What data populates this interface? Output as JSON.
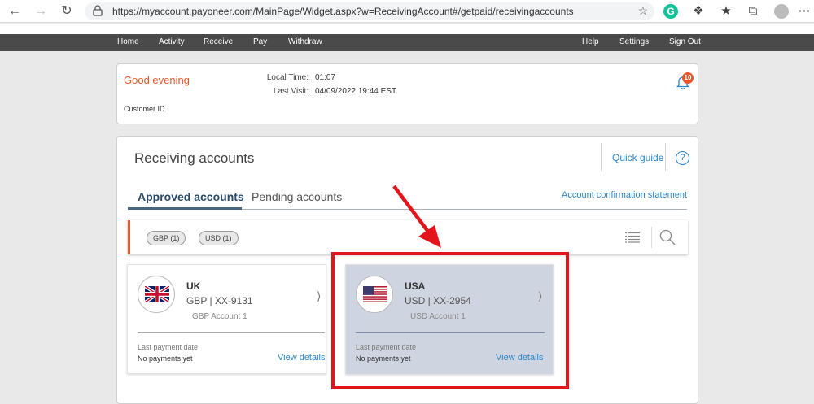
{
  "browser": {
    "url": "https://myaccount.payoneer.com/MainPage/Widget.aspx?w=ReceivingAccount#/getpaid/receivingaccounts"
  },
  "nav": {
    "left": [
      "Home",
      "Activity",
      "Receive",
      "Pay",
      "Withdraw"
    ],
    "right": [
      "Help",
      "Settings",
      "Sign Out"
    ]
  },
  "greeting": {
    "title": "Good evening",
    "customer_id_label": "Customer ID",
    "local_time_label": "Local Time:",
    "local_time_value": "01:07",
    "last_visit_label": "Last Visit:",
    "last_visit_value": "04/09/2022 19:44 EST",
    "notification_count": "10"
  },
  "panel": {
    "title": "Receiving accounts",
    "quick_guide": "Quick guide",
    "help": "?",
    "tabs": [
      "Approved accounts",
      "Pending accounts"
    ],
    "confirm_link": "Account confirmation statement",
    "filters": [
      "GBP (1)",
      "USD (1)"
    ]
  },
  "accounts": [
    {
      "country": "UK",
      "number": "GBP | XX-9131",
      "name": "GBP Account 1",
      "last_payment_label": "Last payment date",
      "last_payment_value": "No payments yet",
      "view_details": "View details"
    },
    {
      "country": "USA",
      "number": "USD | XX-2954",
      "name": "USD Account 1",
      "last_payment_label": "Last payment date",
      "last_payment_value": "No payments yet",
      "view_details": "View details"
    }
  ],
  "colors": {
    "accent_orange": "#e8562a",
    "link_blue": "#2b86c9",
    "annotation_red": "#e4141b",
    "nav_bg": "#4a4a4a"
  }
}
